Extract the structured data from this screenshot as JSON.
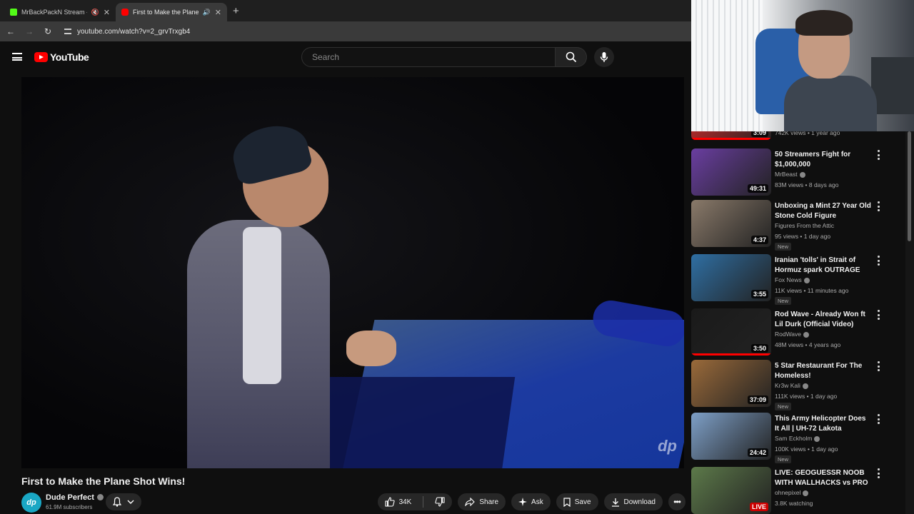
{
  "browser": {
    "tabs": [
      {
        "title": "MrBackPackN Stream - Wa",
        "favicon_color": "#53fc18"
      },
      {
        "title": "First to Make the Plane Sho",
        "favicon_color": "#ff0000"
      }
    ],
    "new_tab_label": "+",
    "url": "youtube.com/watch?v=2_grvTrxgb4"
  },
  "header": {
    "logo_text": "YouTube",
    "search_placeholder": "Search"
  },
  "video": {
    "title": "First to Make the Plane Shot Wins!",
    "watermark": "dp"
  },
  "channel": {
    "name": "Dude Perfect",
    "subscribers": "61.9M subscribers",
    "avatar_text": "dp"
  },
  "actions": {
    "like_count": "34K",
    "share_label": "Share",
    "ask_label": "Ask",
    "save_label": "Save",
    "download_label": "Download"
  },
  "recommendations": [
    {
      "title": "",
      "channel": "",
      "meta": "742K views • 1 year ago",
      "duration": "3:09",
      "new": false,
      "verified": false,
      "partial": true,
      "thumb": "#b22a2a"
    },
    {
      "title": "50 Streamers Fight for $1,000,000",
      "channel": "MrBeast",
      "meta": "83M views • 8 days ago",
      "duration": "49:31",
      "new": false,
      "verified": true,
      "thumb": "#6a3ea1"
    },
    {
      "title": "Unboxing a Mint 27 Year Old Stone Cold Figure",
      "channel": "Figures From the Attic",
      "meta": "95 views • 1 day ago",
      "duration": "4:37",
      "new": true,
      "new_label": "New",
      "verified": false,
      "thumb": "#8a7a6a"
    },
    {
      "title": "Iranian 'tolls' in Strait of Hormuz spark OUTRAGE",
      "channel": "Fox News",
      "meta": "11K views • 11 minutes ago",
      "duration": "3:55",
      "new": true,
      "new_label": "New",
      "verified": true,
      "thumb": "#2f6fa3"
    },
    {
      "title": "Rod Wave - Already Won ft Lil Durk (Official Video)",
      "channel": "RodWave",
      "meta": "48M views • 4 years ago",
      "duration": "3:50",
      "new": false,
      "verified": true,
      "thumb": "#1a1a1a"
    },
    {
      "title": "5 Star Restaurant For The Homeless!",
      "channel": "Kr3w Kali",
      "meta": "111K views • 1 day ago",
      "duration": "37:09",
      "new": true,
      "new_label": "New",
      "verified": true,
      "thumb": "#9a6a3a"
    },
    {
      "title": "This Army Helicopter Does It All | UH-72 Lakota",
      "channel": "Sam Eckholm",
      "meta": "100K views • 1 day ago",
      "duration": "24:42",
      "new": true,
      "new_label": "New",
      "verified": true,
      "thumb": "#7ea0c8"
    },
    {
      "title": "LIVE: GEOGUESSR NOOB WITH WALLHACKS vs PRO",
      "channel": "ohnepixel",
      "meta": "3.8K watching",
      "duration": "LIVE",
      "new": false,
      "verified": true,
      "live": true,
      "thumb": "#5d7a4a"
    }
  ]
}
